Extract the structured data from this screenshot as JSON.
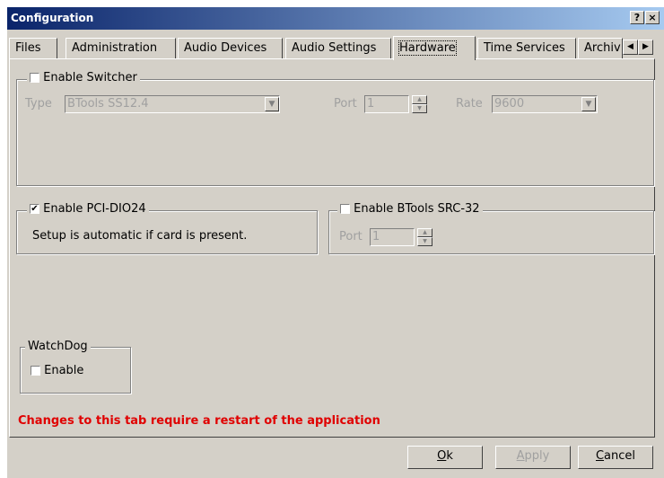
{
  "window": {
    "title": "Configuration",
    "help_btn": "?",
    "close_btn": "×"
  },
  "tabs": [
    {
      "label": "Files"
    },
    {
      "label": "Administration"
    },
    {
      "label": "Audio Devices"
    },
    {
      "label": "Audio Settings"
    },
    {
      "label": "Hardware",
      "active": true
    },
    {
      "label": "Time Services"
    },
    {
      "label": "Archiv"
    }
  ],
  "tab_scroll": {
    "left": "◀",
    "right": "▶"
  },
  "switcher": {
    "label": "Enable Switcher",
    "checked": false,
    "type_label": "Type",
    "type_value": "BTools SS12.4",
    "port_label": "Port",
    "port_value": "1",
    "rate_label": "Rate",
    "rate_value": "9600"
  },
  "pci": {
    "label": "Enable PCI-DIO24",
    "checked": true,
    "note": "Setup is automatic if card is present."
  },
  "src32": {
    "label": "Enable BTools SRC-32",
    "checked": false,
    "port_label": "Port",
    "port_value": "1"
  },
  "watchdog": {
    "title": "WatchDog",
    "enable_label": "Enable",
    "checked": false
  },
  "warning": "Changes to this tab require a restart of the application",
  "buttons": {
    "ok_prefix": "",
    "ok_accel": "O",
    "ok_rest": "k",
    "apply_accel": "A",
    "apply_rest": "pply",
    "cancel_accel": "C",
    "cancel_rest": "ancel"
  },
  "check_glyph": "✔",
  "down_arrow": "▼",
  "up_small": "▲",
  "down_small": "▼"
}
